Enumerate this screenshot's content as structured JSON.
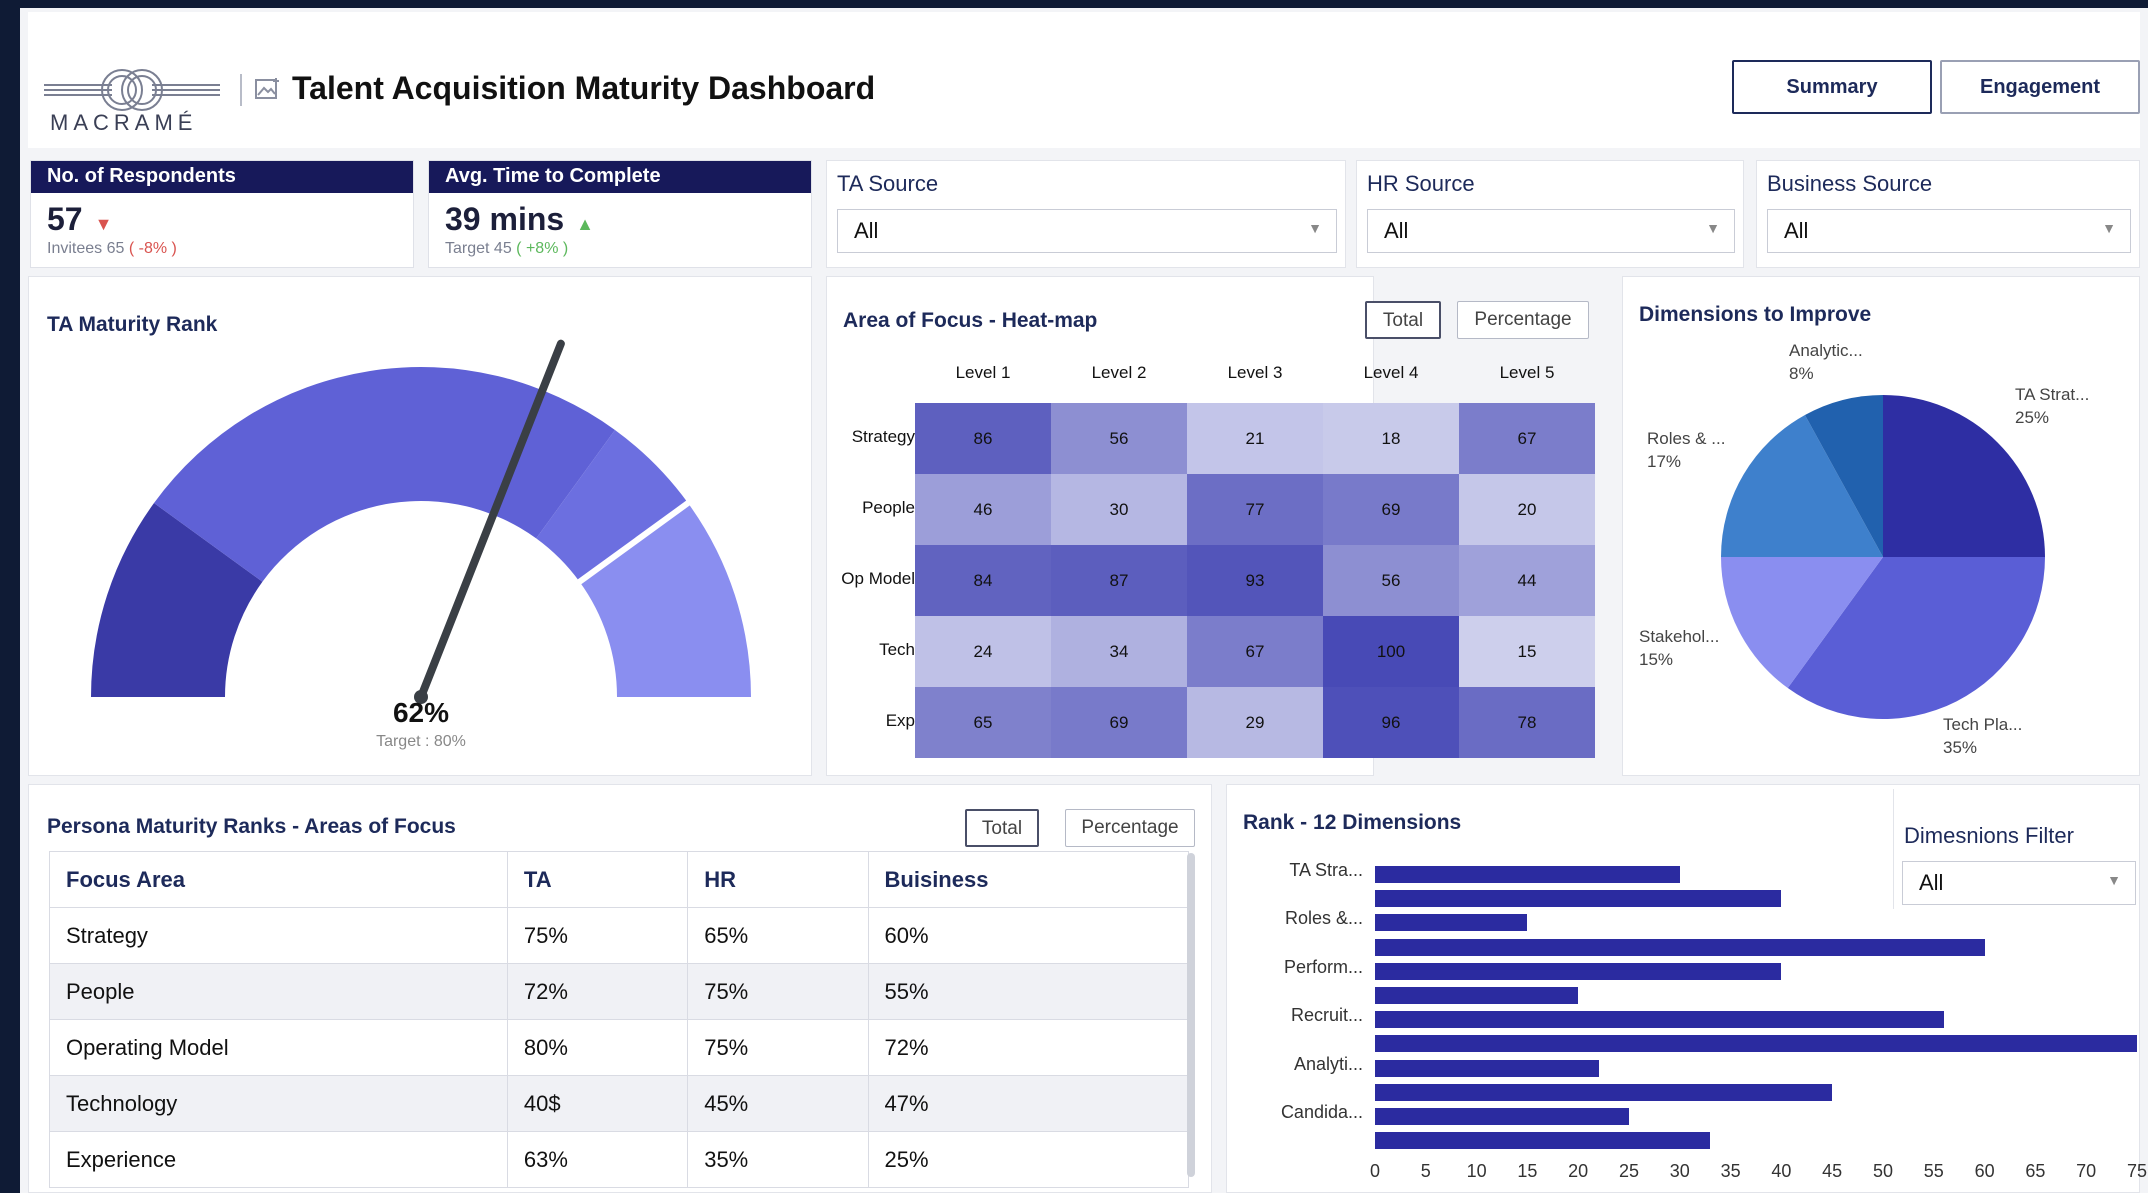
{
  "brand": {
    "logo_text": "MACRAMÉ"
  },
  "header": {
    "title": "Talent Acquisition Maturity Dashboard",
    "tabs": [
      "Summary",
      "Engagement"
    ],
    "active_tab": "Summary"
  },
  "stats": [
    {
      "label": "No. of Respondents",
      "value": "57",
      "trend": "down",
      "arrow": "▼",
      "arrow_color": "#d9534f",
      "sub_label": "Invitees 65",
      "sub_delta": "( -8% )",
      "sub_delta_color": "#d9534f"
    },
    {
      "label": "Avg. Time to Complete",
      "value": "39 mins",
      "trend": "up",
      "arrow": "▲",
      "arrow_color": "#5cb85c",
      "sub_label": "Target 45",
      "sub_delta": "( +8% )",
      "sub_delta_color": "#5cb85c"
    }
  ],
  "filters": [
    {
      "label": "TA Source",
      "value": "All"
    },
    {
      "label": "HR Source",
      "value": "All"
    },
    {
      "label": "Business Source",
      "value": "All"
    }
  ],
  "gauge": {
    "title": "TA Maturity Rank",
    "value_label": "62%",
    "value": 62,
    "target_label": "Target : 80%",
    "target": 80
  },
  "heatmap": {
    "title": "Area of Focus - Heat-map",
    "toggles": [
      "Total",
      "Percentage"
    ],
    "active_toggle": "Total",
    "columns": [
      "Level 1",
      "Level 2",
      "Level 3",
      "Level 4",
      "Level 5"
    ],
    "rows": [
      "Strategy",
      "People",
      "Op Model",
      "Tech",
      "Exp"
    ],
    "values": [
      [
        86,
        56,
        21,
        18,
        67
      ],
      [
        46,
        30,
        77,
        69,
        20
      ],
      [
        84,
        87,
        93,
        56,
        44
      ],
      [
        24,
        34,
        67,
        100,
        15
      ],
      [
        65,
        69,
        29,
        96,
        78
      ]
    ]
  },
  "pie": {
    "title": "Dimensions to Improve",
    "slices": [
      {
        "label": "TA Strat...",
        "pct": "25%",
        "value": 25,
        "color": "#2e2ea3"
      },
      {
        "label": "Tech Pla...",
        "pct": "35%",
        "value": 35,
        "color": "#5a5ed6"
      },
      {
        "label": "Stakehol...",
        "pct": "15%",
        "value": 15,
        "color": "#8a8ef0"
      },
      {
        "label": "Roles & ...",
        "pct": "17%",
        "value": 17,
        "color": "#3e80cc"
      },
      {
        "label": "Analytic...",
        "pct": "8%",
        "value": 8,
        "color": "#2161ae"
      }
    ]
  },
  "persona": {
    "title": "Persona Maturity Ranks - Areas of Focus",
    "toggles": [
      "Total",
      "Percentage"
    ],
    "active_toggle": "Total",
    "headers": [
      "Focus Area",
      "TA",
      "HR",
      "Buisiness"
    ],
    "rows": [
      [
        "Strategy",
        "75%",
        "65%",
        "60%"
      ],
      [
        "People",
        "72%",
        "75%",
        "55%"
      ],
      [
        "Operating Model",
        "80%",
        "75%",
        "72%"
      ],
      [
        "Technology",
        "40$",
        "45%",
        "47%"
      ],
      [
        "Experience",
        "63%",
        "35%",
        "25%"
      ]
    ]
  },
  "rank": {
    "title": "Rank - 12 Dimensions",
    "filter_label": "Dimesnions Filter",
    "filter_value": "All",
    "y_labels": [
      "TA Stra...",
      "Roles &...",
      "Perform...",
      "Recruit...",
      "Analyti...",
      "Candida..."
    ],
    "chart_data": {
      "type": "bar",
      "orientation": "horizontal",
      "values": [
        30,
        40,
        15,
        60,
        40,
        20,
        56,
        75,
        22,
        45,
        25,
        33
      ],
      "xlim": [
        0,
        75
      ],
      "xticks": [
        "0",
        "5",
        "10",
        "15",
        "20",
        "25",
        "30",
        "35",
        "40",
        "45",
        "50",
        "55",
        "60",
        "65",
        "70",
        "75"
      ],
      "color": "#2b2ba0"
    }
  }
}
